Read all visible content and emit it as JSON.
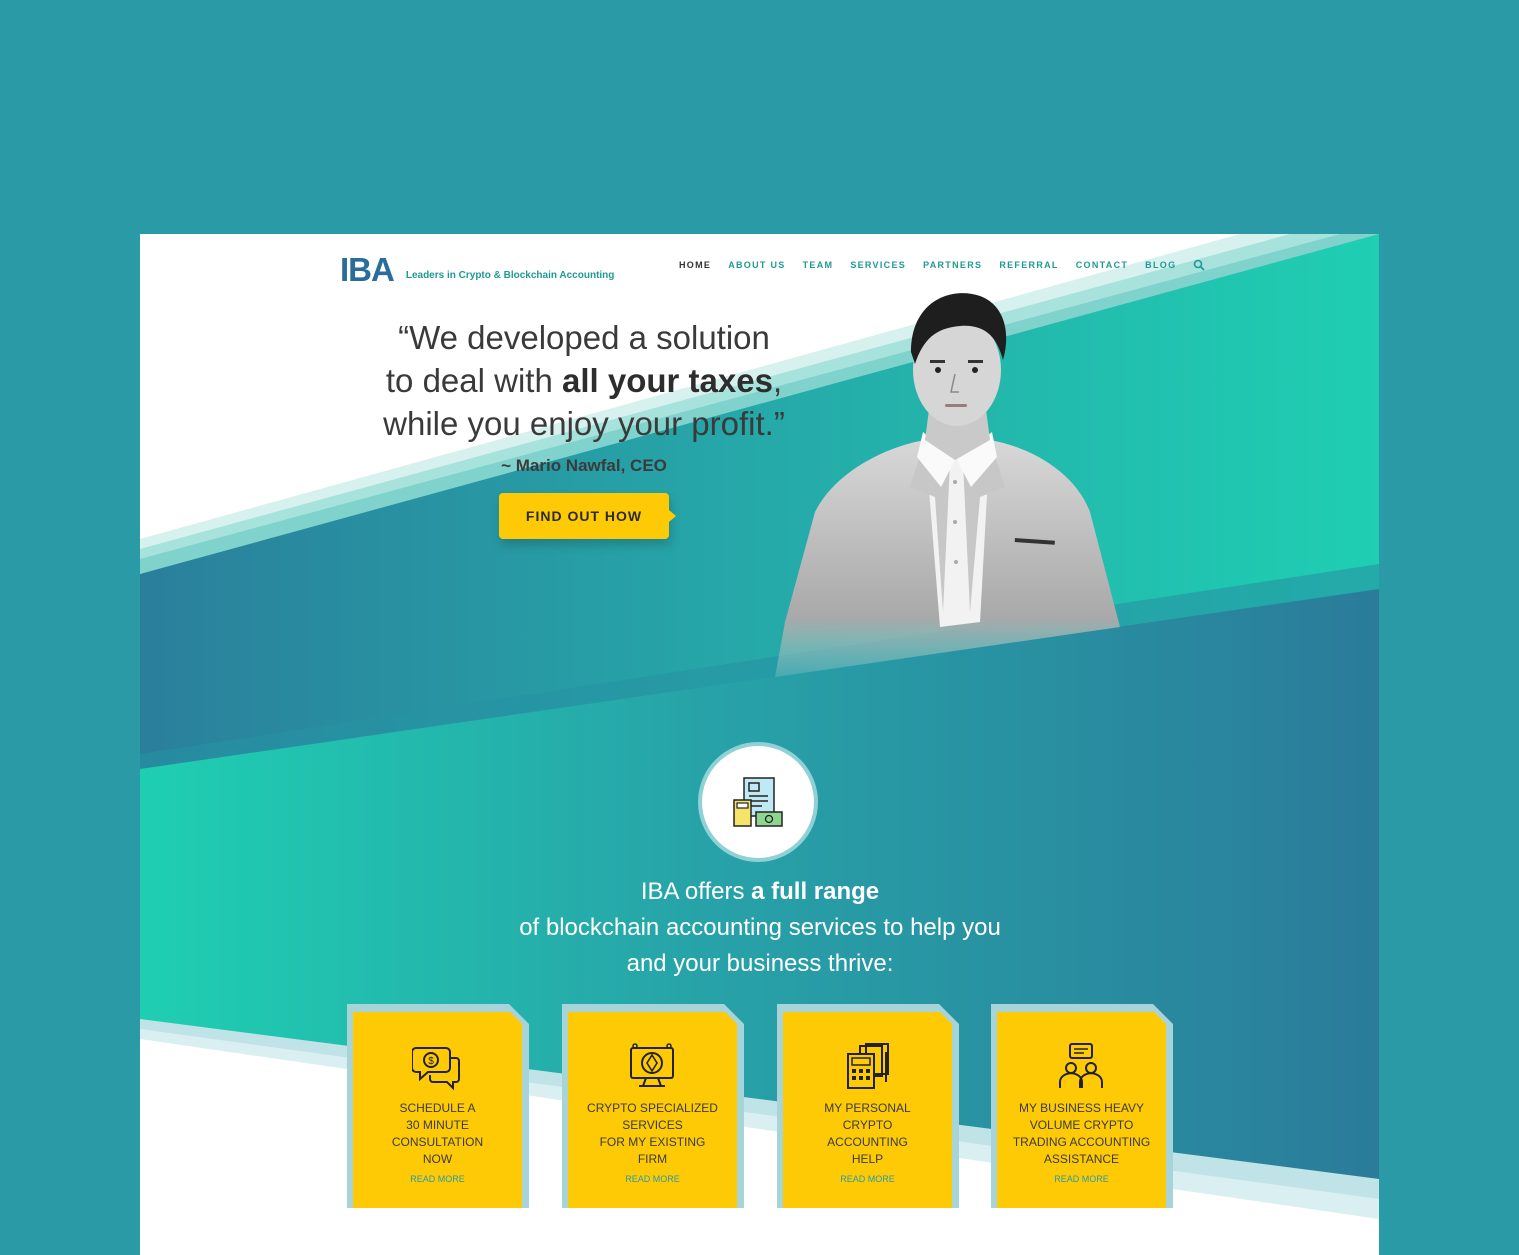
{
  "colors": {
    "outer_bg": "#2a9ba6",
    "teal": "#1fcaae",
    "deep_teal": "#2a7c9a",
    "accent_yellow": "#fdca05",
    "card_link": "#2a9ba6"
  },
  "header": {
    "logo": "IBA",
    "tagline": "Leaders in Crypto & Blockchain Accounting",
    "nav": [
      "HOME",
      "ABOUT US",
      "TEAM",
      "SERVICES",
      "PARTNERS",
      "REFERRAL",
      "CONTACT",
      "BLOG"
    ],
    "active_nav": "HOME",
    "search_icon": "search-icon"
  },
  "hero": {
    "quote_line1": "“We developed a solution",
    "quote_line2_pre": "to deal with ",
    "quote_line2_bold": "all your taxes",
    "quote_line2_post": ",",
    "quote_line3": "while you enjoy your profit.”",
    "author": "~ Mario Nawfal, CEO",
    "cta": "FIND OUT HOW"
  },
  "services": {
    "badge_icon": "accounting-documents-icon",
    "intro_line1_pre": "IBA offers ",
    "intro_line1_bold": "a full range",
    "intro_line2": "of blockchain accounting services to help you",
    "intro_line3": "and your business thrive:",
    "cards": [
      {
        "icon": "consultation-chat-icon",
        "lines": [
          "SCHEDULE A",
          "30 MINUTE",
          "CONSULTATION",
          "NOW"
        ],
        "more": "READ MORE"
      },
      {
        "icon": "crypto-monitor-icon",
        "lines": [
          "CRYPTO SPECIALIZED",
          "SERVICES",
          "FOR MY EXISTING",
          "FIRM"
        ],
        "more": "READ MORE"
      },
      {
        "icon": "calculator-documents-icon",
        "lines": [
          "MY PERSONAL",
          "CRYPTO",
          "ACCOUNTING",
          "HELP"
        ],
        "more": "READ MORE"
      },
      {
        "icon": "business-team-icon",
        "lines": [
          "MY BUSINESS HEAVY",
          "VOLUME CRYPTO",
          "TRADING ACCOUNTING",
          "ASSISTANCE"
        ],
        "more": "READ MORE"
      }
    ]
  }
}
